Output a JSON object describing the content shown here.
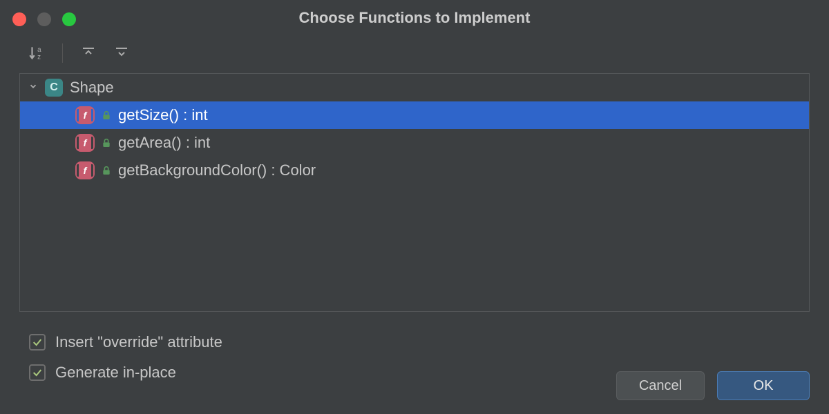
{
  "window": {
    "title": "Choose Functions to Implement"
  },
  "tree": {
    "class_name": "Shape",
    "functions": [
      {
        "signature": "getSize() : int",
        "selected": true
      },
      {
        "signature": "getArea() : int",
        "selected": false
      },
      {
        "signature": "getBackgroundColor() : Color",
        "selected": false
      }
    ]
  },
  "options": {
    "insert_override": {
      "label": "Insert \"override\" attribute",
      "checked": true
    },
    "generate_in_place": {
      "label": "Generate in-place",
      "checked": true
    }
  },
  "buttons": {
    "cancel": "Cancel",
    "ok": "OK"
  }
}
